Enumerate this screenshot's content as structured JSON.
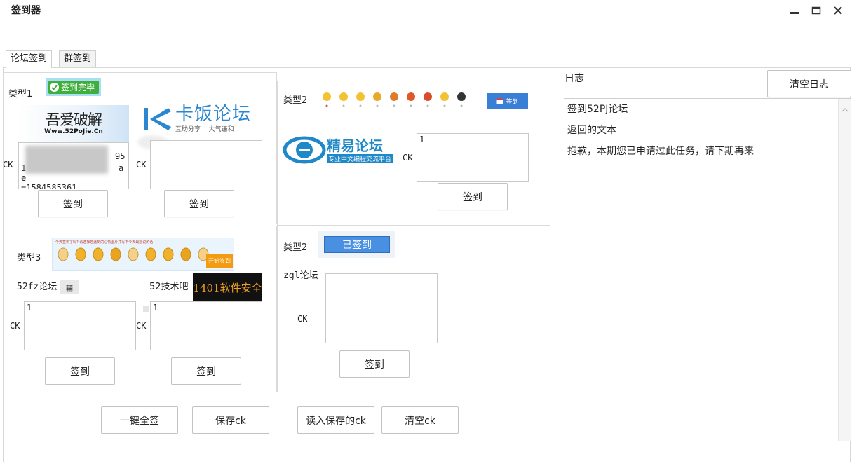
{
  "window": {
    "title": "签到器"
  },
  "tabs": [
    {
      "label": "论坛签到"
    },
    {
      "label": "群签到"
    }
  ],
  "type1": {
    "label": "类型1",
    "done_badge": "签到完毕",
    "site1": {
      "logo_main": "吾爱破解",
      "logo_sub": "Www.52PoJie.Cn",
      "ck_label": "CK",
      "ck_value": "w\n1\ne\n=1584585361",
      "ck_visible_tail_top": "95",
      "ck_visible_tail_mid": "a",
      "button": "签到"
    },
    "site2": {
      "logo_main": "卡饭论坛",
      "logo_sub": "互助分享    大气谦和",
      "ck_label": "CK",
      "ck_value": "",
      "button": "签到"
    }
  },
  "type2_top": {
    "label": "类型2",
    "sign_button_small": "签到",
    "logo_main": "精易论坛",
    "logo_sub": "专业中文编程交流平台",
    "ck_label": "CK",
    "ck_value": "1",
    "button": "签到"
  },
  "type3": {
    "label": "类型3",
    "banner_text": "今天签到了吗? 请选择您此刻的心情图片并写下今天最想说的话!",
    "banner_button": "开始签到",
    "site1": {
      "name": "52fz论坛",
      "badge": "辅",
      "ck_label": "CK",
      "ck_value": "1",
      "button": "签到"
    },
    "site2": {
      "name": "52技术吧",
      "logo_text": "1401软件安全",
      "ck_label": "CK",
      "ck_value": "1",
      "button": "签到"
    }
  },
  "type2_bottom": {
    "label": "类型2",
    "signed_badge": "已签到",
    "site_name": "zgl论坛",
    "ck_label": "CK",
    "ck_value": "",
    "button": "签到"
  },
  "actions": {
    "sign_all": "一键全签",
    "save_ck": "保存ck",
    "load_ck": "读入保存的ck",
    "clear_ck": "清空ck"
  },
  "log": {
    "label": "日志",
    "clear_button": "清空日志",
    "lines": [
      "签到52PJ论坛",
      "返回的文本",
      "抱歉，本期您已申请过此任务，请下期再来"
    ]
  },
  "colors": {
    "accent_blue": "#4a90e2",
    "done_green": "#3fae3a",
    "done_bg": "#a9def5",
    "kafan_blue": "#2a87d0",
    "jingyi_blue": "#1e88c8"
  }
}
